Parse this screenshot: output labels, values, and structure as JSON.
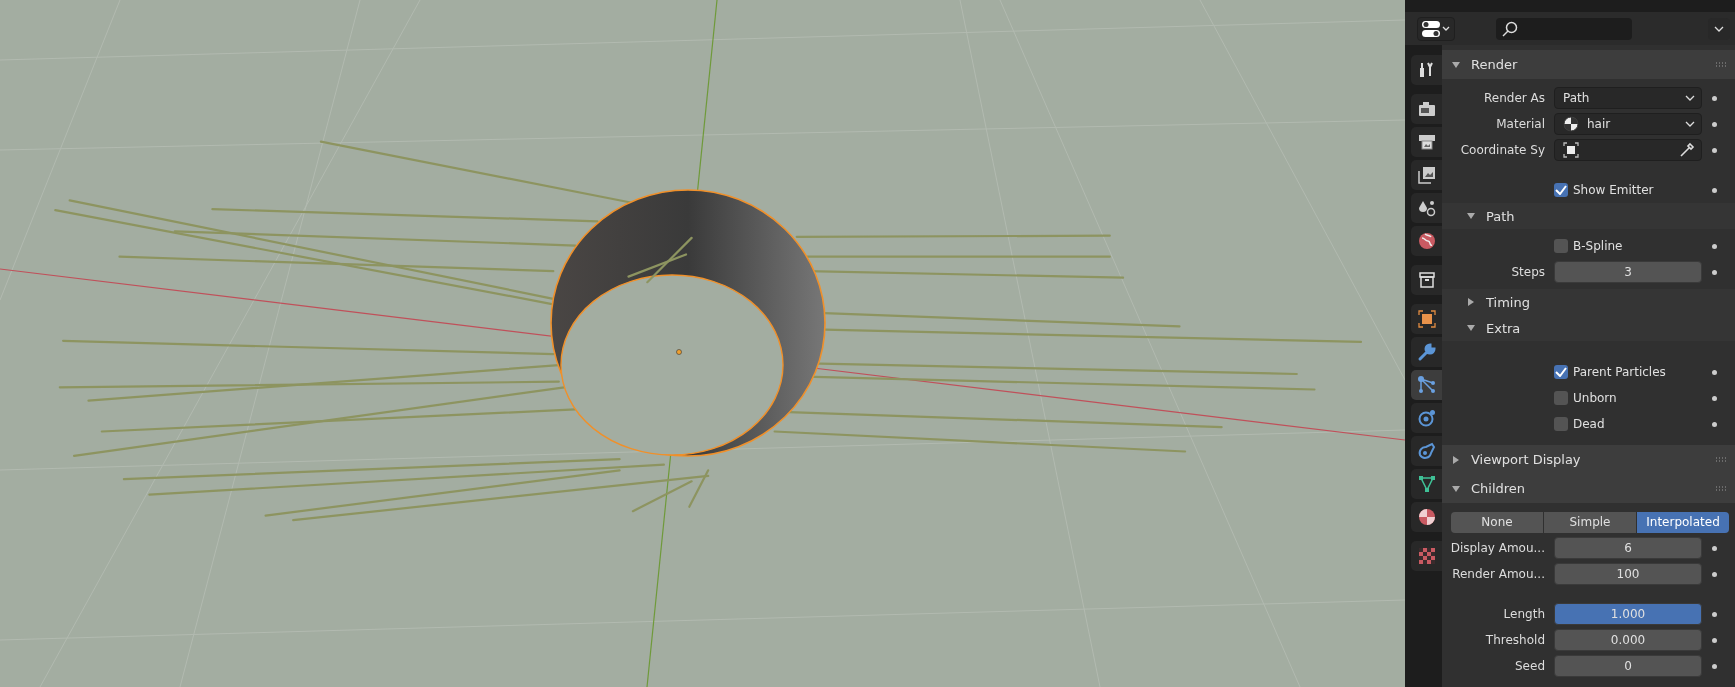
{
  "property_tabs": [
    {
      "kind": "tool",
      "selected": false
    },
    {
      "kind": "render",
      "selected": false
    },
    {
      "kind": "output",
      "selected": false
    },
    {
      "kind": "view_layer",
      "selected": false
    },
    {
      "kind": "scene",
      "selected": false
    },
    {
      "kind": "world",
      "selected": false
    },
    {
      "kind": "collection",
      "selected": false
    },
    {
      "kind": "object",
      "selected": false
    },
    {
      "kind": "modifier",
      "selected": false
    },
    {
      "kind": "particles",
      "selected": true
    },
    {
      "kind": "physics",
      "selected": false
    },
    {
      "kind": "constraints",
      "selected": false
    },
    {
      "kind": "data",
      "selected": false
    },
    {
      "kind": "material",
      "selected": false
    },
    {
      "kind": "texture",
      "selected": false
    }
  ],
  "panels": [
    {
      "title": "Render",
      "expanded": true,
      "rows": [
        {
          "kind": "dropdown",
          "label": "Render As",
          "value": "Path"
        },
        {
          "kind": "material",
          "label": "Material",
          "value": "hair"
        },
        {
          "kind": "object_field",
          "label": "Coordinate Sy"
        },
        {
          "kind": "spacer"
        },
        {
          "kind": "checkbox",
          "label": "Show Emitter",
          "checked": true
        }
      ],
      "subpanels": [
        {
          "title": "Path",
          "expanded": true,
          "rows": [
            {
              "kind": "checkbox",
              "label": "B-Spline",
              "checked": false
            },
            {
              "kind": "number",
              "label": "Steps",
              "value": "3",
              "highlighted": false
            }
          ]
        },
        {
          "title": "Timing",
          "expanded": false
        },
        {
          "title": "Extra",
          "expanded": true,
          "rows": [
            {
              "kind": "spacer"
            },
            {
              "kind": "checkbox",
              "label": "Parent Particles",
              "checked": true
            },
            {
              "kind": "checkbox",
              "label": "Unborn",
              "checked": false
            },
            {
              "kind": "checkbox",
              "label": "Dead",
              "checked": false
            }
          ]
        }
      ]
    },
    {
      "title": "Viewport Display",
      "expanded": false
    },
    {
      "title": "Children",
      "expanded": true,
      "rows": [
        {
          "kind": "segmented",
          "options": [
            {
              "label": "None",
              "selected": false
            },
            {
              "label": "Simple",
              "selected": false
            },
            {
              "label": "Interpolated",
              "selected": true
            }
          ]
        },
        {
          "kind": "number",
          "label": "Display Amou...",
          "value": "6",
          "highlighted": false
        },
        {
          "kind": "number",
          "label": "Render Amou...",
          "value": "100",
          "highlighted": false
        },
        {
          "kind": "spacer"
        },
        {
          "kind": "number",
          "label": "Length",
          "value": "1.000",
          "highlighted": true
        },
        {
          "kind": "number",
          "label": "Threshold",
          "value": "0.000",
          "highlighted": false
        },
        {
          "kind": "number",
          "label": "Seed",
          "value": "0",
          "highlighted": false
        }
      ]
    }
  ]
}
